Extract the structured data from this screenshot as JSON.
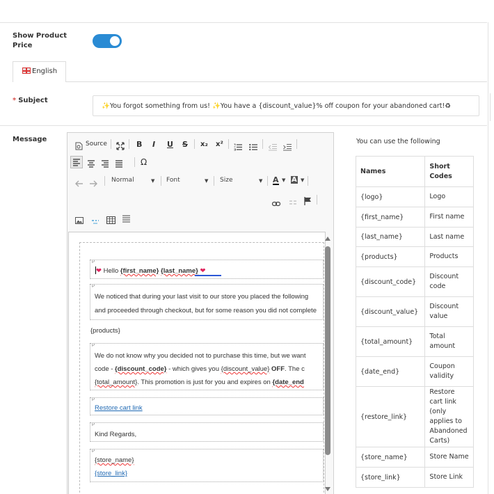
{
  "show_price": {
    "label_line1": "Show Product",
    "label_line2": "Price",
    "enabled": true
  },
  "tabs": [
    {
      "label": "English"
    }
  ],
  "subject": {
    "required_mark": "*",
    "label": "Subject",
    "value": "✨You forgot something from us! ✨You have a {discount_value}% off coupon for your abandoned cart!♻"
  },
  "message": {
    "label": "Message",
    "toolbar": {
      "source": "Source",
      "bold": "B",
      "italic": "I",
      "underline": "U",
      "strike": "S",
      "subscript": "x₂",
      "superscript": "x²",
      "omega": "Ω",
      "format": "Normal",
      "font": "Font",
      "size": "Size",
      "text_color": "A",
      "bg_color": "A"
    },
    "content": {
      "p_marker": "P",
      "hello_prefix": "Hello ",
      "first_name": "{first_name}",
      "space": " ",
      "last_name": "{last_name}",
      "line1": "We noticed that during your last visit to our store you placed the following",
      "line2": "and proceeded through checkout, but for some reason you did not complete",
      "products": "{products}",
      "line3": "We do not know why you decided not to purchase this time, but we want",
      "line4_a": "code - ",
      "line4_code": "{discount_code}",
      "line4_b": " - which gives you ",
      "line4_val": "{discount_value}",
      "line4_c": " OFF",
      "line4_d": ". The c",
      "line5_amount": "{total_amount}",
      "line5_b": ". This promotion is just for you and expires on ",
      "line5_end": "{date_end",
      "restore": "Restore cart link",
      "regards": "Kind Regards,",
      "store_name": "{store_name}",
      "store_link": "{store_link}"
    }
  },
  "shortcodes": {
    "hint": "You can use the following",
    "col_names": "Names",
    "col_codes_1": "Short",
    "col_codes_2": "Codes",
    "rows": [
      {
        "code": "{logo}",
        "desc": "Logo"
      },
      {
        "code": "{first_name}",
        "desc": "First name"
      },
      {
        "code": "{last_name}",
        "desc": "Last name"
      },
      {
        "code": "{products}",
        "desc": "Products"
      },
      {
        "code": "{discount_code}",
        "desc": "Discount code"
      },
      {
        "code": "{discount_value}",
        "desc": "Discount value"
      },
      {
        "code": "{total_amount}",
        "desc": "Total amount"
      },
      {
        "code": "{date_end}",
        "desc": "Coupon validity"
      },
      {
        "code": "{restore_link}",
        "desc": "Restore cart link (only applies to Abandoned Carts)"
      },
      {
        "code": "{store_name}",
        "desc": "Store Name"
      },
      {
        "code": "{store_link}",
        "desc": "Store Link"
      }
    ]
  },
  "colors": {
    "toggle": "#2a8bd4",
    "link": "#1f69b3",
    "required": "#d9534f"
  }
}
